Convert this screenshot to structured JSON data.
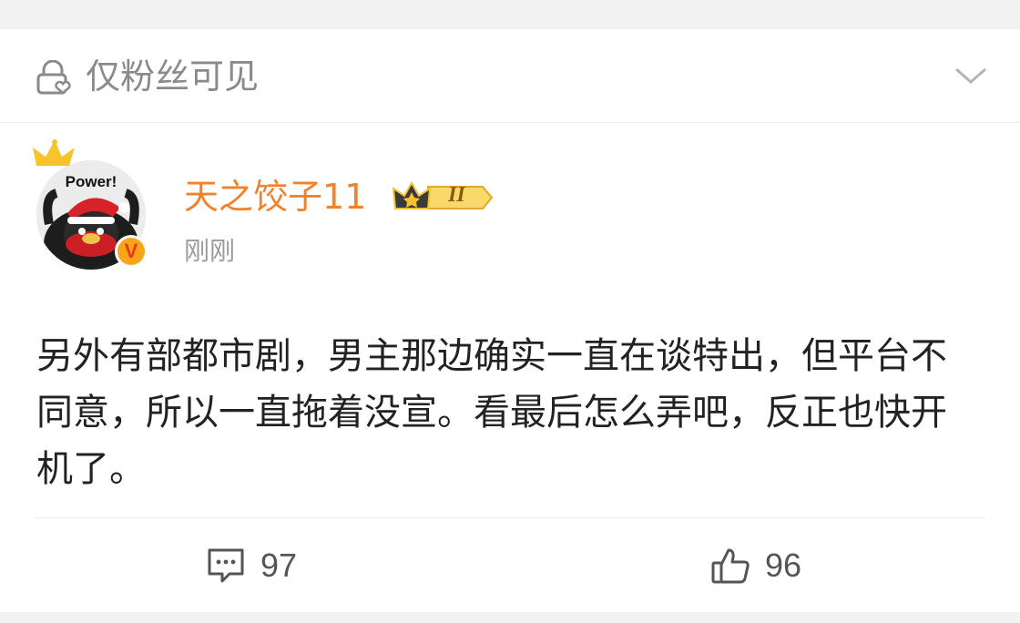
{
  "visibility": {
    "label": "仅粉丝可见",
    "icon": "lock-heart-icon",
    "toggle_icon": "chevron-down-icon"
  },
  "author": {
    "avatar_text": "Power!",
    "name": "天之饺子11",
    "badge_icon": "vip-crown-badge-icon",
    "badge_text": "II",
    "verified_mark": "V",
    "time": "刚刚"
  },
  "post": {
    "text": "另外有部都市剧，男主那边确实一直在谈特出，但平台不同意，所以一直拖着没宣。看最后怎么弄吧，反正也快开机了。"
  },
  "actions": {
    "comments": "97",
    "likes": "96"
  },
  "colors": {
    "username": "#f2812b",
    "muted": "#8a8a8a",
    "verified": "#f8a51b"
  }
}
